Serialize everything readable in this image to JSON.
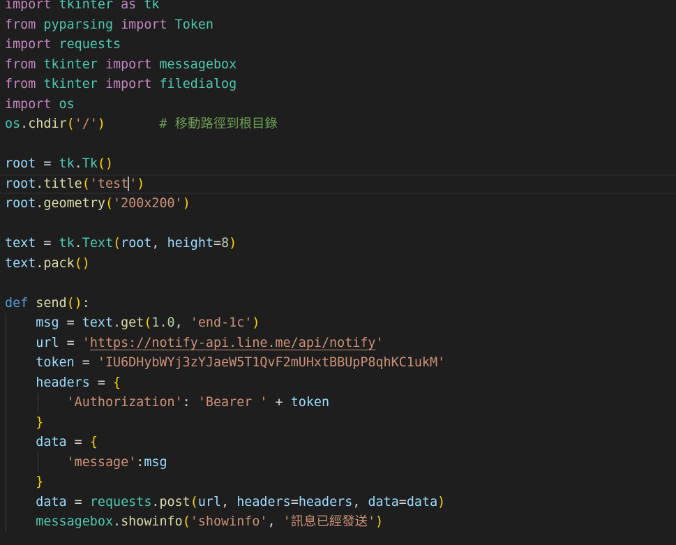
{
  "editor": {
    "lines": [
      [
        {
          "t": "import",
          "c": "kw"
        },
        {
          "t": " ",
          "c": "op"
        },
        {
          "t": "tkinter",
          "c": "mod"
        },
        {
          "t": " ",
          "c": "op"
        },
        {
          "t": "as",
          "c": "kw"
        },
        {
          "t": " ",
          "c": "op"
        },
        {
          "t": "tk",
          "c": "mod"
        }
      ],
      [
        {
          "t": "from",
          "c": "kw"
        },
        {
          "t": " ",
          "c": "op"
        },
        {
          "t": "pyparsing",
          "c": "mod"
        },
        {
          "t": " ",
          "c": "op"
        },
        {
          "t": "import",
          "c": "kw"
        },
        {
          "t": " ",
          "c": "op"
        },
        {
          "t": "Token",
          "c": "cls"
        }
      ],
      [
        {
          "t": "import",
          "c": "kw"
        },
        {
          "t": " ",
          "c": "op"
        },
        {
          "t": "requests",
          "c": "mod"
        }
      ],
      [
        {
          "t": "from",
          "c": "kw"
        },
        {
          "t": " ",
          "c": "op"
        },
        {
          "t": "tkinter",
          "c": "mod"
        },
        {
          "t": " ",
          "c": "op"
        },
        {
          "t": "import",
          "c": "kw"
        },
        {
          "t": " ",
          "c": "op"
        },
        {
          "t": "messagebox",
          "c": "mod"
        }
      ],
      [
        {
          "t": "from",
          "c": "kw"
        },
        {
          "t": " ",
          "c": "op"
        },
        {
          "t": "tkinter",
          "c": "mod"
        },
        {
          "t": " ",
          "c": "op"
        },
        {
          "t": "import",
          "c": "kw"
        },
        {
          "t": " ",
          "c": "op"
        },
        {
          "t": "filedialog",
          "c": "mod"
        }
      ],
      [
        {
          "t": "import",
          "c": "kw"
        },
        {
          "t": " ",
          "c": "op"
        },
        {
          "t": "os",
          "c": "mod"
        }
      ],
      [
        {
          "t": "os",
          "c": "mod"
        },
        {
          "t": ".",
          "c": "pun"
        },
        {
          "t": "chdir",
          "c": "fn"
        },
        {
          "t": "(",
          "c": "p1"
        },
        {
          "t": "'/'",
          "c": "str"
        },
        {
          "t": ")",
          "c": "p1"
        },
        {
          "t": "       ",
          "c": "op"
        },
        {
          "t": "# 移動路徑到根目錄",
          "c": "cmt"
        }
      ],
      [],
      [
        {
          "t": "root",
          "c": "var"
        },
        {
          "t": " = ",
          "c": "op"
        },
        {
          "t": "tk",
          "c": "mod"
        },
        {
          "t": ".",
          "c": "pun"
        },
        {
          "t": "Tk",
          "c": "cls"
        },
        {
          "t": "()",
          "c": "p1"
        }
      ],
      [
        {
          "t": "root",
          "c": "var"
        },
        {
          "t": ".",
          "c": "pun"
        },
        {
          "t": "title",
          "c": "fn"
        },
        {
          "t": "(",
          "c": "p1"
        },
        {
          "t": "'test",
          "c": "str"
        },
        {
          "t": "'",
          "c": "str",
          "cursor": true
        },
        {
          "t": ")",
          "c": "p1"
        }
      ],
      [
        {
          "t": "root",
          "c": "var"
        },
        {
          "t": ".",
          "c": "pun"
        },
        {
          "t": "geometry",
          "c": "fn"
        },
        {
          "t": "(",
          "c": "p1"
        },
        {
          "t": "'200x200'",
          "c": "str"
        },
        {
          "t": ")",
          "c": "p1"
        }
      ],
      [],
      [
        {
          "t": "text",
          "c": "var"
        },
        {
          "t": " = ",
          "c": "op"
        },
        {
          "t": "tk",
          "c": "mod"
        },
        {
          "t": ".",
          "c": "pun"
        },
        {
          "t": "Text",
          "c": "cls"
        },
        {
          "t": "(",
          "c": "p1"
        },
        {
          "t": "root",
          "c": "var"
        },
        {
          "t": ", ",
          "c": "pun"
        },
        {
          "t": "height",
          "c": "var"
        },
        {
          "t": "=",
          "c": "op"
        },
        {
          "t": "8",
          "c": "num"
        },
        {
          "t": ")",
          "c": "p1"
        }
      ],
      [
        {
          "t": "text",
          "c": "var"
        },
        {
          "t": ".",
          "c": "pun"
        },
        {
          "t": "pack",
          "c": "fn"
        },
        {
          "t": "()",
          "c": "p1"
        }
      ],
      [],
      [
        {
          "t": "def",
          "c": "def"
        },
        {
          "t": " ",
          "c": "op"
        },
        {
          "t": "send",
          "c": "fn"
        },
        {
          "t": "()",
          "c": "p1"
        },
        {
          "t": ":",
          "c": "pun"
        }
      ],
      [
        {
          "t": "    ",
          "c": "op"
        },
        {
          "t": "msg",
          "c": "var"
        },
        {
          "t": " = ",
          "c": "op"
        },
        {
          "t": "text",
          "c": "var"
        },
        {
          "t": ".",
          "c": "pun"
        },
        {
          "t": "get",
          "c": "fn"
        },
        {
          "t": "(",
          "c": "p1"
        },
        {
          "t": "1.0",
          "c": "num"
        },
        {
          "t": ", ",
          "c": "pun"
        },
        {
          "t": "'end-1c'",
          "c": "str"
        },
        {
          "t": ")",
          "c": "p1"
        }
      ],
      [
        {
          "t": "    ",
          "c": "op"
        },
        {
          "t": "url",
          "c": "var"
        },
        {
          "t": " = ",
          "c": "op"
        },
        {
          "t": "'",
          "c": "str"
        },
        {
          "t": "https://notify-api.line.me/api/notify",
          "c": "str",
          "u": true
        },
        {
          "t": "'",
          "c": "str"
        }
      ],
      [
        {
          "t": "    ",
          "c": "op"
        },
        {
          "t": "token",
          "c": "var"
        },
        {
          "t": " = ",
          "c": "op"
        },
        {
          "t": "'IU6DHybWYj3zYJaeW5T1QvF2mUHxtBBUpP8qhKC1ukM'",
          "c": "str"
        }
      ],
      [
        {
          "t": "    ",
          "c": "op"
        },
        {
          "t": "headers",
          "c": "var"
        },
        {
          "t": " = ",
          "c": "op"
        },
        {
          "t": "{",
          "c": "p1"
        }
      ],
      [
        {
          "t": "        ",
          "c": "op"
        },
        {
          "t": "'Authorization'",
          "c": "str"
        },
        {
          "t": ": ",
          "c": "pun"
        },
        {
          "t": "'Bearer '",
          "c": "str"
        },
        {
          "t": " + ",
          "c": "op"
        },
        {
          "t": "token",
          "c": "var"
        }
      ],
      [
        {
          "t": "    ",
          "c": "op"
        },
        {
          "t": "}",
          "c": "p1"
        }
      ],
      [
        {
          "t": "    ",
          "c": "op"
        },
        {
          "t": "data",
          "c": "var"
        },
        {
          "t": " = ",
          "c": "op"
        },
        {
          "t": "{",
          "c": "p1"
        }
      ],
      [
        {
          "t": "        ",
          "c": "op"
        },
        {
          "t": "'message'",
          "c": "str"
        },
        {
          "t": ":",
          "c": "pun"
        },
        {
          "t": "msg",
          "c": "var"
        }
      ],
      [
        {
          "t": "    ",
          "c": "op"
        },
        {
          "t": "}",
          "c": "p1"
        }
      ],
      [
        {
          "t": "    ",
          "c": "op"
        },
        {
          "t": "data",
          "c": "var"
        },
        {
          "t": " = ",
          "c": "op"
        },
        {
          "t": "requests",
          "c": "mod"
        },
        {
          "t": ".",
          "c": "pun"
        },
        {
          "t": "post",
          "c": "fn"
        },
        {
          "t": "(",
          "c": "p1"
        },
        {
          "t": "url",
          "c": "var"
        },
        {
          "t": ", ",
          "c": "pun"
        },
        {
          "t": "headers",
          "c": "var"
        },
        {
          "t": "=",
          "c": "op"
        },
        {
          "t": "headers",
          "c": "var"
        },
        {
          "t": ", ",
          "c": "pun"
        },
        {
          "t": "data",
          "c": "var"
        },
        {
          "t": "=",
          "c": "op"
        },
        {
          "t": "data",
          "c": "var"
        },
        {
          "t": ")",
          "c": "p1"
        }
      ],
      [
        {
          "t": "    ",
          "c": "op"
        },
        {
          "t": "messagebox",
          "c": "mod"
        },
        {
          "t": ".",
          "c": "pun"
        },
        {
          "t": "showinfo",
          "c": "fn"
        },
        {
          "t": "(",
          "c": "p1"
        },
        {
          "t": "'showinfo'",
          "c": "str"
        },
        {
          "t": ", ",
          "c": "pun"
        },
        {
          "t": "'訊息已經發送'",
          "c": "str"
        },
        {
          "t": ")",
          "c": "p1"
        }
      ]
    ],
    "current_line_index": 9,
    "theme": {
      "background": "#1e1e1e",
      "keyword": "#c586c0",
      "function": "#dcdcaa",
      "variable": "#9cdcfe",
      "module": "#4ec9b0",
      "string": "#ce9178",
      "number": "#b5cea8",
      "comment": "#6a9955",
      "bracket": "#ffd700"
    }
  }
}
